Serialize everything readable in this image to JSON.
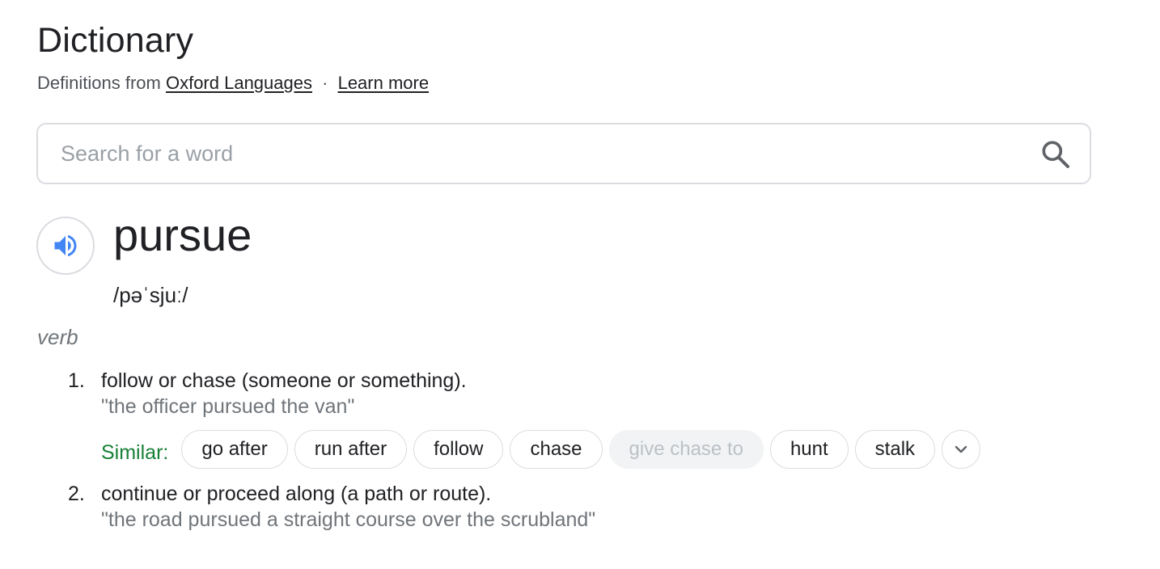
{
  "header": {
    "title": "Dictionary",
    "source_prefix": "Definitions from",
    "source_link": "Oxford Languages",
    "separator": "·",
    "learn_more": "Learn more"
  },
  "search": {
    "placeholder": "Search for a word",
    "value": ""
  },
  "entry": {
    "word": "pursue",
    "phonetic": "/pəˈsjuː/",
    "part_of_speech": "verb",
    "senses": [
      {
        "number": "1.",
        "definition": "follow or chase (someone or something).",
        "example": "\"the officer pursued the van\"",
        "similar_label": "Similar:",
        "similar": [
          {
            "label": "go after",
            "enabled": true
          },
          {
            "label": "run after",
            "enabled": true
          },
          {
            "label": "follow",
            "enabled": true
          },
          {
            "label": "chase",
            "enabled": true
          },
          {
            "label": "give chase to",
            "enabled": false
          },
          {
            "label": "hunt",
            "enabled": true
          },
          {
            "label": "stalk",
            "enabled": true
          }
        ]
      },
      {
        "number": "2.",
        "definition": "continue or proceed along (a path or route).",
        "example": "\"the road pursued a straight course over the scrubland\""
      }
    ]
  },
  "icons": {
    "search": "search-icon",
    "speaker": "speaker-icon",
    "expand": "chevron-down-icon"
  },
  "colors": {
    "speaker_blue": "#4285f4",
    "similar_green": "#188038",
    "muted_text": "#70757a"
  }
}
